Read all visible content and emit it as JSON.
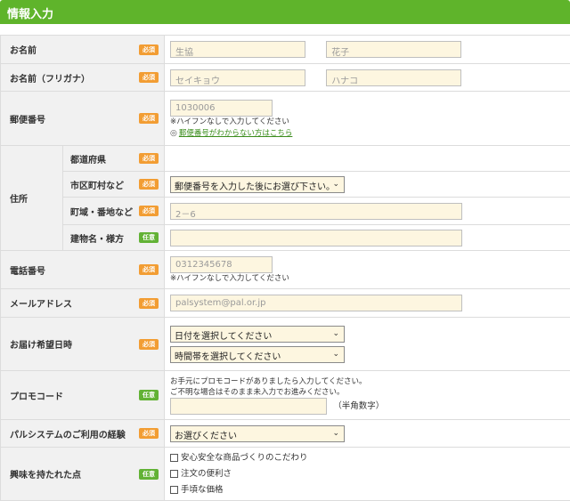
{
  "header": {
    "title": "情報入力"
  },
  "badges": {
    "required": "必須",
    "optional": "任意"
  },
  "fields": {
    "name": {
      "label": "お名前",
      "last_placeholder": "生協",
      "first_placeholder": "花子"
    },
    "name_kana": {
      "label": "お名前（フリガナ）",
      "last_placeholder": "セイキョウ",
      "first_placeholder": "ハナコ"
    },
    "postal": {
      "label": "郵便番号",
      "placeholder": "1030006",
      "note": "※ハイフンなしで入力してください",
      "link": "郵便番号がわからない方はこちら"
    },
    "address": {
      "label": "住所",
      "prefecture": {
        "label": "都道府県"
      },
      "city": {
        "label": "市区町村など",
        "value": "郵便番号を入力した後にお選び下さい。"
      },
      "street": {
        "label": "町域・番地など",
        "placeholder": "2－6"
      },
      "building": {
        "label": "建物名・様方",
        "placeholder": ""
      }
    },
    "phone": {
      "label": "電話番号",
      "placeholder": "0312345678",
      "note": "※ハイフンなしで入力してください"
    },
    "email": {
      "label": "メールアドレス",
      "placeholder": "palsystem@pal.or.jp"
    },
    "delivery": {
      "label": "お届け希望日時",
      "date_value": "日付を選択してください",
      "time_value": "時間帯を選択してください"
    },
    "promo": {
      "label": "プロモコード",
      "note1": "お手元にプロモコードがありましたら入力してください。",
      "note2": "ご不明な場合はそのまま未入力でお進みください。",
      "placeholder": "",
      "suffix": "（半角数字）"
    },
    "experience": {
      "label": "パルシステムのご利用の経験",
      "value": "お選びください"
    },
    "interests": {
      "label": "興味を持たれた点",
      "options": [
        "安心安全な商品づくりのこだわり",
        "注文の便利さ",
        "手頃な価格"
      ]
    }
  }
}
